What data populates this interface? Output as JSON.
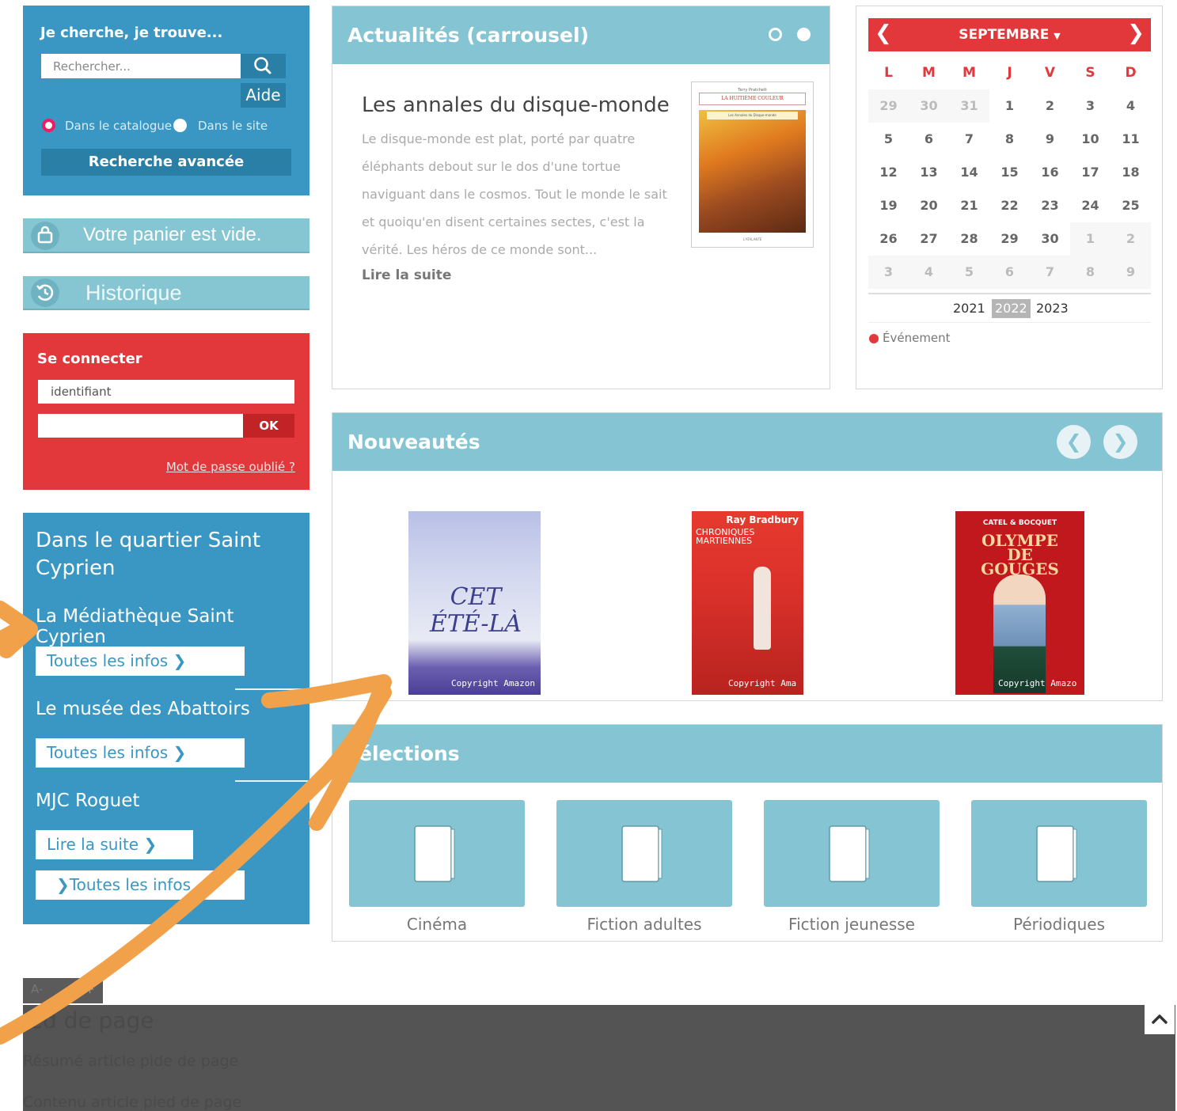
{
  "search": {
    "title": "Je cherche, je trouve...",
    "placeholder": "Rechercher...",
    "help_label": "Aide",
    "option_catalogue": "Dans le catalogue",
    "option_site": "Dans le site",
    "selected_option": "catalogue",
    "advanced_label": "Recherche avancée"
  },
  "basket": {
    "text": "Votre panier est vide.",
    "icon": "basket-icon"
  },
  "history": {
    "text": "Historique",
    "icon": "history-icon"
  },
  "login": {
    "title": "Se connecter",
    "id_value": "identifiant",
    "ok_label": "OK",
    "forgot_label": "Mot de passe oublié ?"
  },
  "quarter": {
    "title": "Dans le quartier Saint Cyprien",
    "places": [
      {
        "name": "La Médiathèque Saint Cyprien",
        "button": "Toutes les infos"
      },
      {
        "name": "Le musée des Abattoirs",
        "button": "Toutes les infos"
      },
      {
        "name": "MJC Roguet",
        "button": "Lire la suite",
        "button2": "Toutes les infos"
      }
    ]
  },
  "news": {
    "title": "Actualités (carrousel)",
    "article_title": "Les annales du disque-monde",
    "summary": "Le disque-monde est plat, porté par quatre éléphants debout sur le dos d'une tortue naviguant dans le cosmos. Tout le monde le sait et quoiqu'en disent certaines sectes, c'est la vérité. Les héros de ce monde sont...",
    "more_label": "Lire la suite",
    "cover": {
      "author": "Terry Pratchett",
      "title": "LA HUITIÈME COULEUR",
      "subtitle": "Les Annales du Disque-monde",
      "publisher": "L'ATALANTE"
    },
    "active_slide": 2,
    "slide_count": 2
  },
  "calendar": {
    "month": "SEPTEMBRE",
    "weekdays": [
      "L",
      "M",
      "M",
      "J",
      "V",
      "S",
      "D"
    ],
    "weeks": [
      [
        "29",
        "30",
        "31",
        "1",
        "2",
        "3",
        "4"
      ],
      [
        "5",
        "6",
        "7",
        "8",
        "9",
        "10",
        "11"
      ],
      [
        "12",
        "13",
        "14",
        "15",
        "16",
        "17",
        "18"
      ],
      [
        "19",
        "20",
        "21",
        "22",
        "23",
        "24",
        "25"
      ],
      [
        "26",
        "27",
        "28",
        "29",
        "30",
        "1",
        "2"
      ],
      [
        "3",
        "4",
        "5",
        "6",
        "7",
        "8",
        "9"
      ]
    ],
    "years": [
      "2021",
      "2022",
      "2023"
    ],
    "current_year": "2022",
    "legend": "Événement",
    "event_color": "#e2383c"
  },
  "new_titles": {
    "title": "Nouveautés",
    "books": [
      {
        "title": "CET ÉTÉ-LÀ",
        "copyright": "Copyright Amazon"
      },
      {
        "author": "Ray Bradbury",
        "title": "CHRONIQUES MARTIENNES",
        "copyright": "Copyright Ama"
      },
      {
        "author": "CATEL & BOCQUET",
        "title": "OLYMPE DE GOUGES",
        "copyright": "Copyright Amazo"
      }
    ]
  },
  "selections": {
    "title": "élections",
    "items": [
      "Cinéma",
      "Fiction adultes",
      "Fiction jeunesse",
      "Périodiques"
    ]
  },
  "footer": {
    "font_minus": "A-",
    "font_plus": "A+",
    "title": "ied de page",
    "summary": "Résumé article pide de page",
    "content": "Contenu article pied de page"
  },
  "colors": {
    "search_blue": "#3a97c3",
    "light_teal": "#85c5d3",
    "login_red": "#e2383c",
    "footer_grey": "#545454",
    "annotation_orange": "#f2a14b"
  }
}
